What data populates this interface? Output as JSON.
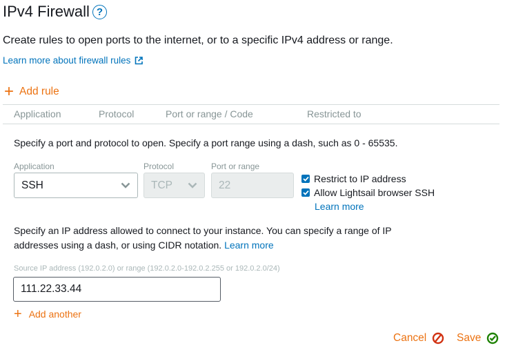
{
  "header": {
    "title": "IPv4 Firewall",
    "help_icon": "question-circle-icon",
    "description": "Create rules to open ports to the internet, or to a specific IPv4 address or range.",
    "learn_more_label": "Learn more about firewall rules",
    "external_icon": "external-link-icon"
  },
  "add_rule": {
    "label": "Add rule",
    "icon": "plus-icon"
  },
  "table": {
    "columns": [
      "Application",
      "Protocol",
      "Port or range / Code",
      "Restricted to"
    ]
  },
  "rule_editor": {
    "port_hint": "Specify a port and protocol to open. Specify a port range using a dash, such as 0 - 65535.",
    "application": {
      "label": "Application",
      "value": "SSH"
    },
    "protocol": {
      "label": "Protocol",
      "value": "TCP",
      "disabled": true
    },
    "port": {
      "label": "Port or range",
      "value": "22",
      "disabled": true
    },
    "checkboxes": [
      {
        "label": "Restrict to IP address",
        "checked": true
      },
      {
        "label": "Allow Lightsail browser SSH",
        "checked": true
      }
    ],
    "checkbox_learn_more": "Learn more",
    "ip_hint": "Specify an IP address allowed to connect to your instance. You can specify a range of IP",
    "ip_hint_line2": "addresses using a dash, or using CIDR notation.",
    "ip_hint_learn_more": "Learn more",
    "source_ip": {
      "label": "Source IP address (192.0.2.0) or range (192.0.2.0-192.0.2.255 or 192.0.2.0/24)",
      "value": "111.22.33.44"
    },
    "add_another_label": "Add another"
  },
  "footer": {
    "cancel_label": "Cancel",
    "save_label": "Save"
  },
  "colors": {
    "accent_orange": "#ec7211",
    "link_blue": "#0073bb",
    "save_green": "#1d8102",
    "cancel_red": "#d13212"
  }
}
